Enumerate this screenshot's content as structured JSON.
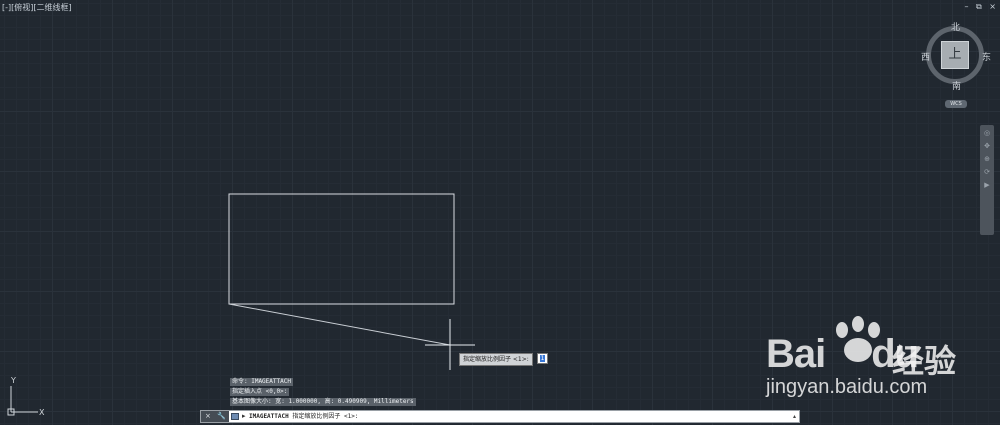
{
  "viewport": {
    "label": "[-][俯视][二维线框]"
  },
  "window_controls": [
    "–",
    "⧉",
    "×"
  ],
  "viewcube": {
    "north": "北",
    "south": "南",
    "west": "西",
    "east": "东",
    "face": "上",
    "wcs": "WCS"
  },
  "navbar": {
    "icons": [
      "steering-wheel",
      "pan",
      "zoom",
      "orbit",
      "showmotion"
    ]
  },
  "ucs": {
    "x_label": "X",
    "y_label": "Y"
  },
  "dynamic_input": {
    "prompt": "指定缩放比例因子 <1>:",
    "value": "1"
  },
  "command_history": [
    "命令: IMAGEATTACH",
    "指定插入点 <0,0>:",
    "基本图像大小: 宽: 1.000000, 高: 0.490909, Millimeters"
  ],
  "command_line": {
    "tools": [
      "×",
      "🔧"
    ],
    "prompt_symbol": "▸",
    "command": "IMAGEATTACH",
    "text": " 指定缩放比例因子 <1>:",
    "scroll": "▴"
  },
  "watermark": {
    "brand": "Bai",
    "brand_suffix": "du",
    "cn": "经验",
    "url": "jingyan.baidu.com"
  },
  "colors": {
    "background": "#212830",
    "grid": "#2a323b",
    "geometry": "#d9dde2",
    "command_bg": "#ffffff"
  }
}
